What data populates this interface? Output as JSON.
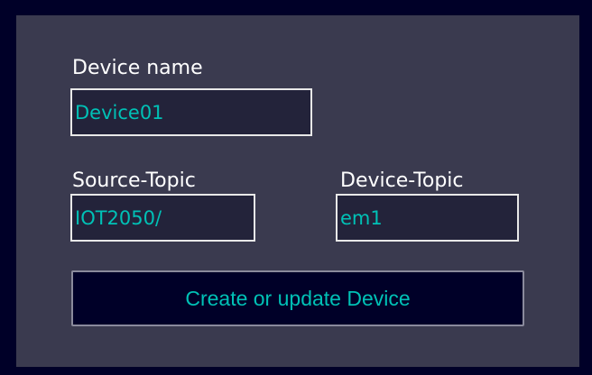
{
  "form": {
    "device_name": {
      "label": "Device name",
      "value": "Device01"
    },
    "source_topic": {
      "label": "Source-Topic",
      "value": "IOT2050/"
    },
    "device_topic": {
      "label": "Device-Topic",
      "value": "em1"
    },
    "submit_label": "Create or update Device"
  },
  "colors": {
    "outer_background": "#000028",
    "panel_background": "#3a3a4f",
    "field_background": "#23233a",
    "field_text": "#00c1b6",
    "label_text": "#ffffff",
    "button_background": "#000028"
  }
}
